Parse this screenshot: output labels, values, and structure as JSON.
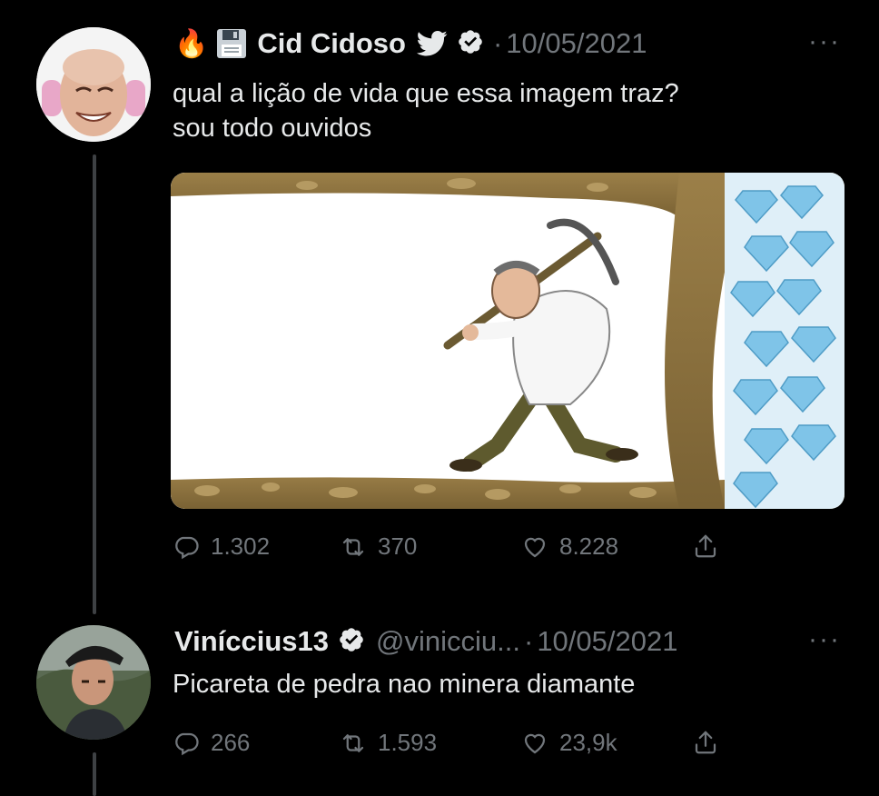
{
  "tweet1": {
    "display_name": "Cid Cidoso",
    "emoji_prefix": "🔥",
    "date": "10/05/2021",
    "text_line1": "qual a lição de vida que essa imagem traz?",
    "text_line2": "sou todo ouvidos",
    "more": "···",
    "separator": "·",
    "stats": {
      "replies": "1.302",
      "retweets": "370",
      "likes": "8.228"
    }
  },
  "tweet2": {
    "display_name": "Viníccius13",
    "handle": "@vinicciu...",
    "date": "10/05/2021",
    "text": "Picareta de pedra nao minera diamante",
    "more": "···",
    "separator": "·",
    "stats": {
      "replies": "266",
      "retweets": "1.593",
      "likes": "23,9k"
    }
  },
  "colors": {
    "background": "#000000",
    "text": "#e7e9ea",
    "muted": "#71767b",
    "twitter_blue": "#1d9bf0",
    "thread_line": "#3e4144",
    "cave_brown": "#8b6f3a",
    "diamond": "#7fc4e8"
  },
  "icons": [
    "fire-emoji",
    "floppy-disk-icon",
    "twitter-bird-icon",
    "verified-badge-icon",
    "more-icon",
    "reply-icon",
    "retweet-icon",
    "like-icon",
    "share-icon"
  ]
}
